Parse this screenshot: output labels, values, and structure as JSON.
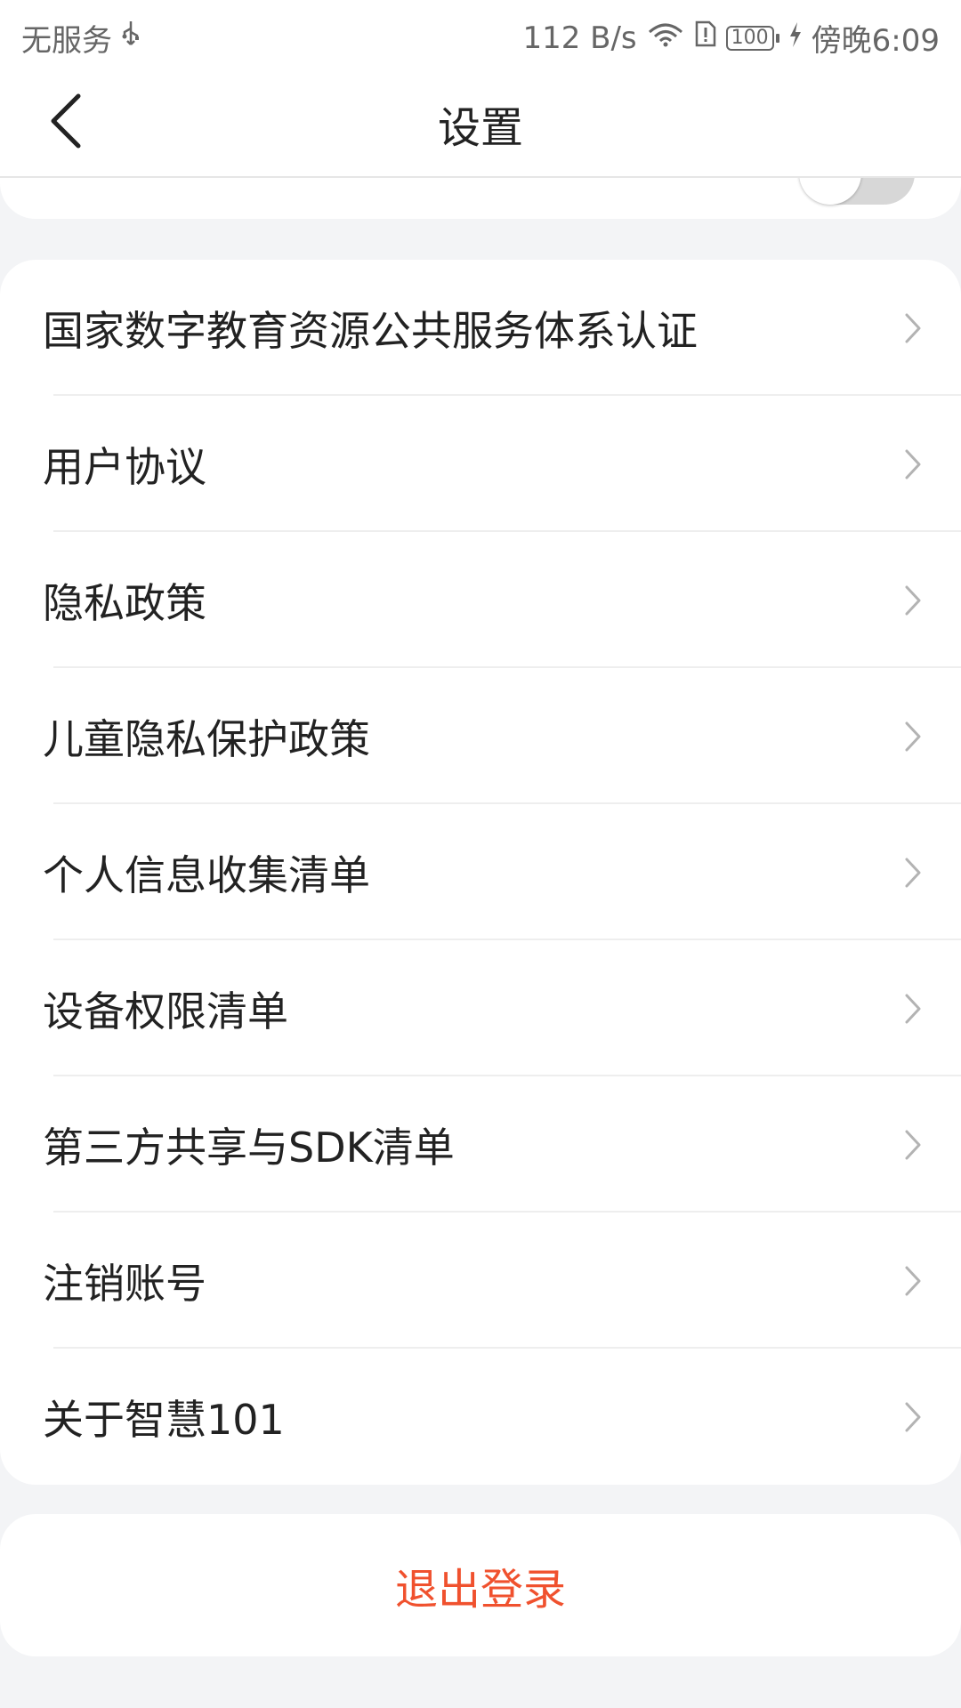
{
  "status_bar": {
    "carrier": "无服务",
    "speed": "112 B/s",
    "battery": "100",
    "time": "傍晚6:09"
  },
  "header": {
    "title": "设置"
  },
  "previous_section": {
    "toggle_state": "off"
  },
  "menu": {
    "items": [
      {
        "label": "国家数字教育资源公共服务体系认证"
      },
      {
        "label": "用户协议"
      },
      {
        "label": "隐私政策"
      },
      {
        "label": "儿童隐私保护政策"
      },
      {
        "label": "个人信息收集清单"
      },
      {
        "label": "设备权限清单"
      },
      {
        "label": "第三方共享与SDK清单"
      },
      {
        "label": "注销账号"
      },
      {
        "label": "关于智慧101"
      }
    ]
  },
  "logout": {
    "label": "退出登录"
  },
  "colors": {
    "accent": "#f0512e",
    "background": "#f3f4f6",
    "card": "#ffffff"
  }
}
